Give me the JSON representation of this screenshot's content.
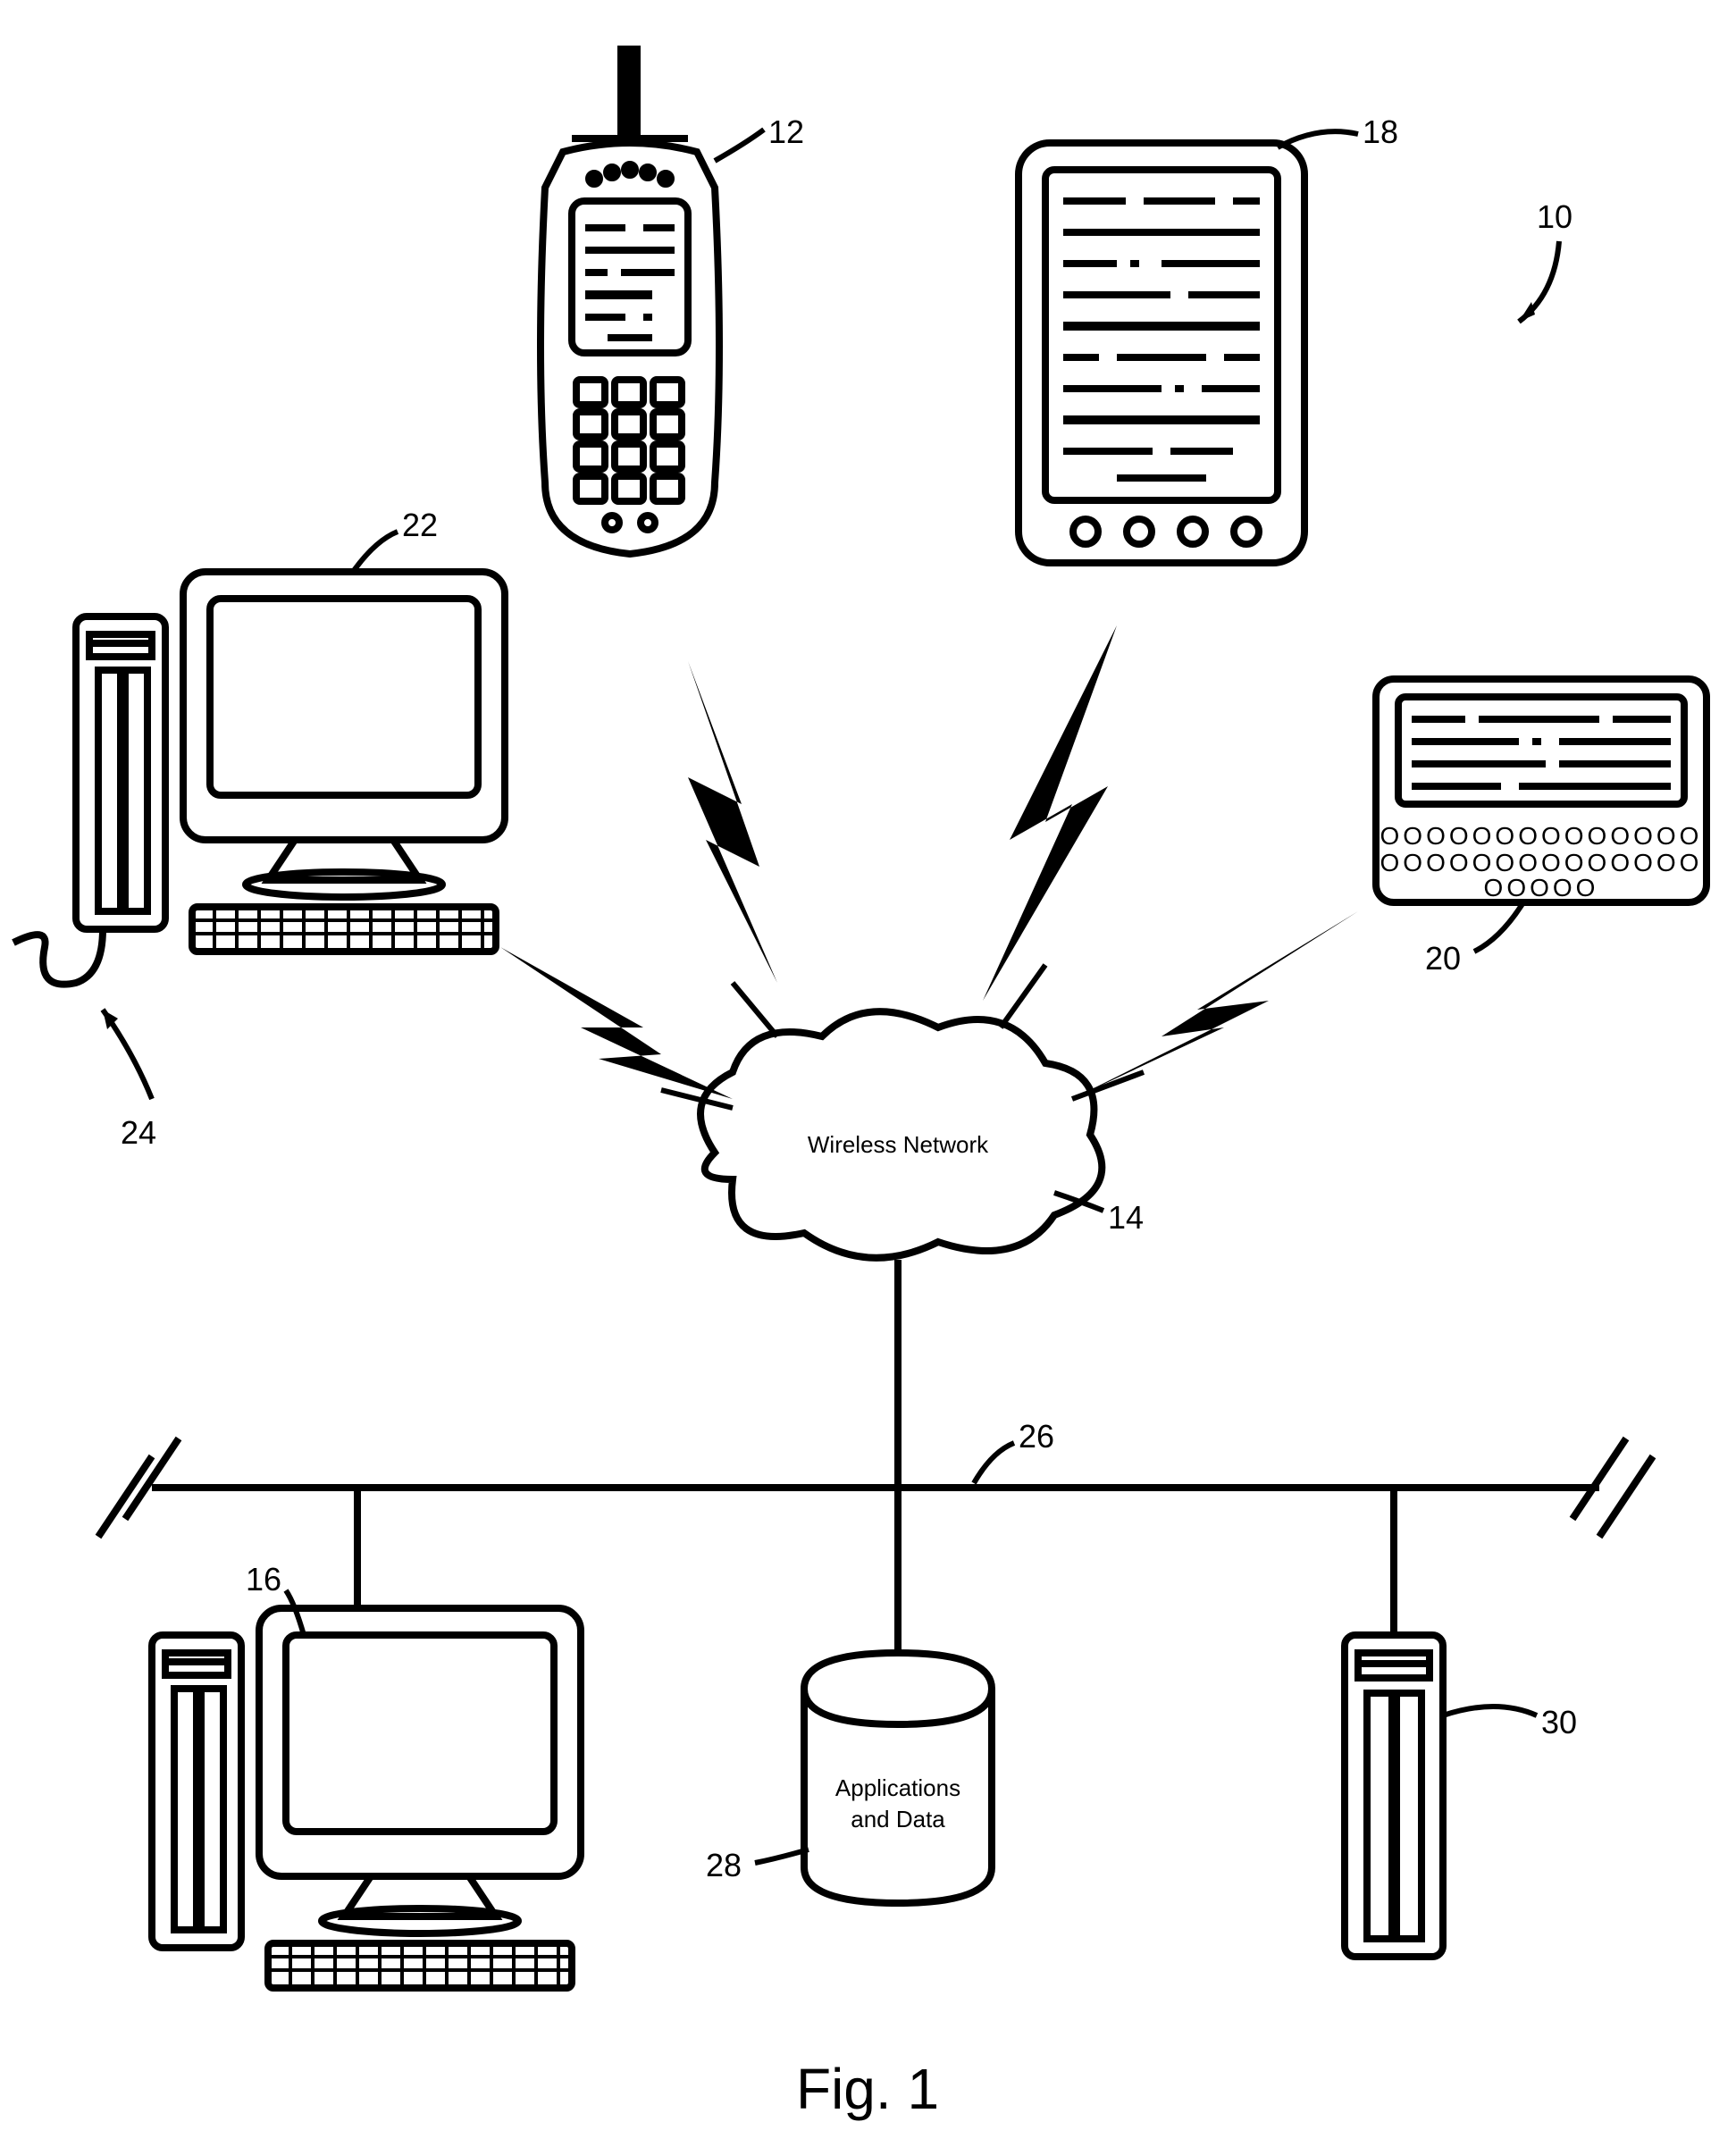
{
  "figure_label": "Fig. 1",
  "cloud_label": "Wireless Network",
  "db_line1": "Applications",
  "db_line2": "and Data",
  "refs": {
    "system": "10",
    "phone": "12",
    "cloud": "14",
    "pc_lower": "16",
    "tablet": "18",
    "pager": "20",
    "pc_upper": "22",
    "wired_conn": "24",
    "bus": "26",
    "db": "28",
    "server": "30"
  }
}
